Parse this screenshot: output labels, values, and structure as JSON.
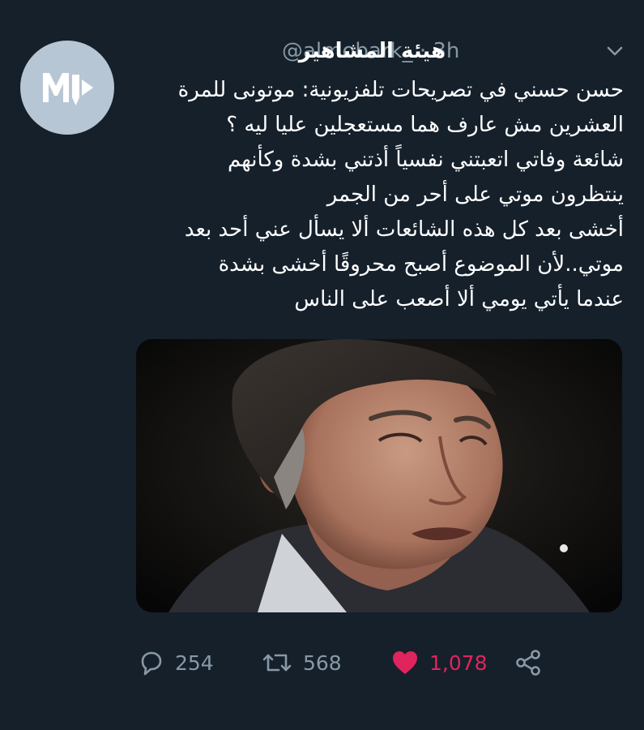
{
  "tweet": {
    "author_name": "هيئة المشاهير",
    "handle": "@almobark_",
    "time": "· 3h",
    "text_lines": [
      "حسن حسني في تصريحات تلفزيونية: موتونى للمرة",
      "العشرين مش عارف هما مستعجلين عليا ليه ؟",
      "شائعة وفاتي اتعبتني نفسياً أذتني بشدة وكأنهم",
      "ينتظرون موتي على أحر من الجمر",
      "أخشى بعد كل هذه الشائعات ألا يسأل عني أحد بعد",
      "موتي..لأن الموضوع أصبح محروقًا أخشى بشدة",
      "عندما يأتي يومي ألا أصعب على الناس"
    ],
    "replies": "254",
    "retweets": "568",
    "likes": "1,078",
    "liked": true
  },
  "icons": {
    "avatar": "media-logo-icon",
    "caret": "chevron-down-icon",
    "reply": "reply-icon",
    "retweet": "retweet-icon",
    "like": "heart-icon",
    "share": "share-icon"
  },
  "colors": {
    "background": "#15202b",
    "secondary_text": "#8899a6",
    "like_active": "#e0245e",
    "avatar_bg": "#b7c6d4"
  }
}
